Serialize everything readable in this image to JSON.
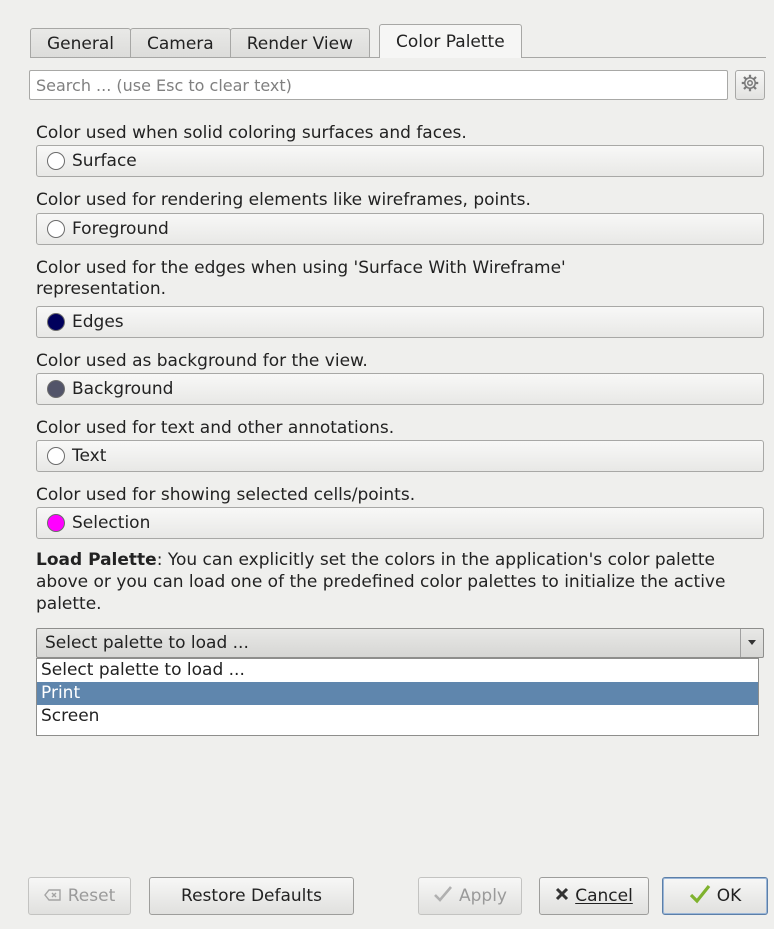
{
  "tabs": [
    {
      "label": "General"
    },
    {
      "label": "Camera"
    },
    {
      "label": "Render View"
    },
    {
      "label": "Color Palette"
    }
  ],
  "search": {
    "placeholder": "Search ... (use Esc to clear text)"
  },
  "colors": [
    {
      "description": "Color used when solid coloring surfaces and faces.",
      "label": "Surface",
      "swatch": "#ffffff"
    },
    {
      "description": "Color used for rendering elements like wireframes, points.",
      "label": "Foreground",
      "swatch": "#ffffff"
    },
    {
      "description": "Color used for the edges when using 'Surface With Wireframe' representation.",
      "label": "Edges",
      "swatch": "#00005c"
    },
    {
      "description": "Color used as background for the view.",
      "label": "Background",
      "swatch": "#525469"
    },
    {
      "description": "Color used for text and other annotations.",
      "label": "Text",
      "swatch": "#ffffff"
    },
    {
      "description": "Color used for showing selected cells/points.",
      "label": "Selection",
      "swatch": "#ff00ff"
    }
  ],
  "load_palette": {
    "bold_label": "Load Palette",
    "text": ": You can explicitly set the colors in the application's color palette above or you can load one of the predefined color palettes to initialize the active palette.",
    "selected": "Select palette to load ...",
    "options": [
      "Select palette to load ...",
      "Print",
      "Screen"
    ],
    "highlighted": "Print"
  },
  "buttons": {
    "reset": "Reset",
    "restore": "Restore Defaults",
    "apply": "Apply",
    "cancel": "Cancel",
    "ok": "OK"
  }
}
